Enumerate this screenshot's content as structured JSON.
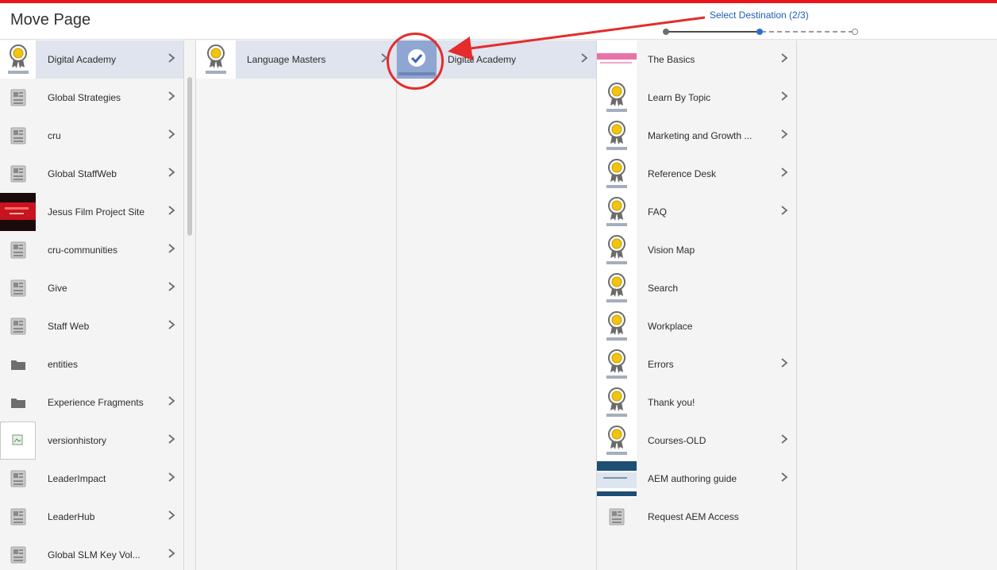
{
  "header": {
    "title": "Move Page",
    "wizard": {
      "label": "Select Destination (2/3)",
      "step": 2,
      "total": 3
    }
  },
  "columns": [
    {
      "items": [
        {
          "label": "Digital Academy",
          "thumb": "academy",
          "chevron": true,
          "selected": true
        },
        {
          "label": "Global Strategies",
          "thumb": "doc",
          "chevron": true
        },
        {
          "label": "cru",
          "thumb": "doc",
          "chevron": true
        },
        {
          "label": "Global StaffWeb",
          "thumb": "doc",
          "chevron": true
        },
        {
          "label": "Jesus Film Project Site",
          "thumb": "video",
          "chevron": true
        },
        {
          "label": "cru-communities",
          "thumb": "doc",
          "chevron": true
        },
        {
          "label": "Give",
          "thumb": "doc",
          "chevron": true
        },
        {
          "label": "Staff Web",
          "thumb": "doc",
          "chevron": true
        },
        {
          "label": "entities",
          "thumb": "folder",
          "chevron": false
        },
        {
          "label": "Experience Fragments",
          "thumb": "folder",
          "chevron": true
        },
        {
          "label": "versionhistory",
          "thumb": "broken",
          "chevron": true
        },
        {
          "label": "LeaderImpact",
          "thumb": "doc",
          "chevron": true
        },
        {
          "label": "LeaderHub",
          "thumb": "doc",
          "chevron": true
        },
        {
          "label": "Global SLM Key Vol...",
          "thumb": "doc",
          "chevron": true
        }
      ]
    },
    {
      "items": [
        {
          "label": "Language Masters",
          "thumb": "academy",
          "chevron": true,
          "selected": true
        }
      ]
    },
    {
      "items": [
        {
          "label": "Digital Academy",
          "thumb": "check",
          "chevron": true,
          "selected": true
        }
      ]
    },
    {
      "items": [
        {
          "label": "The Basics",
          "thumb": "pink",
          "chevron": true
        },
        {
          "label": "Learn By Topic",
          "thumb": "academy",
          "chevron": true
        },
        {
          "label": "Marketing and Growth ...",
          "thumb": "academy",
          "chevron": true
        },
        {
          "label": "Reference Desk",
          "thumb": "academy",
          "chevron": true
        },
        {
          "label": "FAQ",
          "thumb": "academy",
          "chevron": true
        },
        {
          "label": "Vision Map",
          "thumb": "academy",
          "chevron": false
        },
        {
          "label": "Search",
          "thumb": "academy",
          "chevron": false
        },
        {
          "label": "Workplace",
          "thumb": "academy",
          "chevron": false
        },
        {
          "label": "Errors",
          "thumb": "academy",
          "chevron": true
        },
        {
          "label": "Thank you!",
          "thumb": "academy",
          "chevron": false
        },
        {
          "label": "Courses-OLD",
          "thumb": "academy",
          "chevron": true
        },
        {
          "label": "AEM authoring guide",
          "thumb": "guide",
          "chevron": true
        },
        {
          "label": "Request AEM Access",
          "thumb": "doc",
          "chevron": false
        }
      ]
    }
  ],
  "icons": {
    "chevron": "chevron-right-icon",
    "academy": "award-ribbon-icon",
    "doc": "page-icon",
    "folder": "folder-icon",
    "check": "checkmark-icon"
  },
  "colors": {
    "accent_bar": "#e8141a",
    "selected_row": "#dfe4ee",
    "wizard_blue": "#1a5fb4",
    "annotation_red": "#e52b2b"
  }
}
